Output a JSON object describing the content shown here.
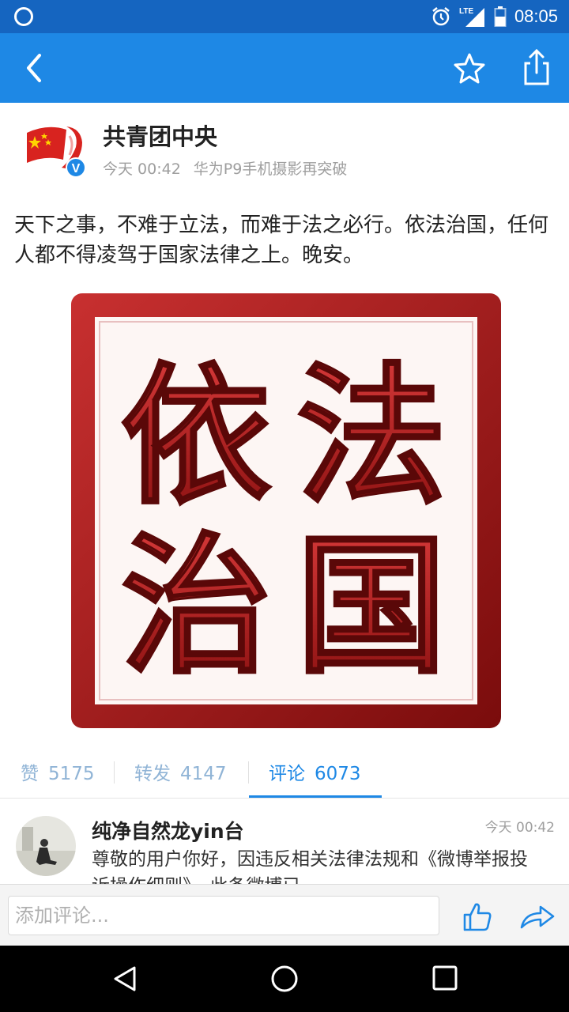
{
  "status_bar": {
    "time": "08:05",
    "network": "LTE"
  },
  "post": {
    "author": "共青团中央",
    "time": "今天 00:42",
    "source": "华为P9手机摄影再突破",
    "text": "天下之事，不难于立法，而难于法之必行。依法治国，任何人都不得凌驾于国家法律之上。晚安。",
    "image_chars": [
      "依",
      "法",
      "治",
      "国"
    ]
  },
  "stats": {
    "likes_label": "赞",
    "likes": "5175",
    "reposts_label": "转发",
    "reposts": "4147",
    "comments_label": "评论",
    "comments": "6073"
  },
  "comment": {
    "name": "纯净自然龙yin台",
    "time": "今天 00:42",
    "text": "尊敬的用户你好，因违反相关法律法规和《微博举报投诉操作细则》，此条微博已"
  },
  "comment_bar": {
    "placeholder": "添加评论..."
  },
  "colors": {
    "statusbar": "#1565c0",
    "appbar": "#1e88e5",
    "seal_red": "#b01c1c",
    "accent": "#1e88e5"
  }
}
